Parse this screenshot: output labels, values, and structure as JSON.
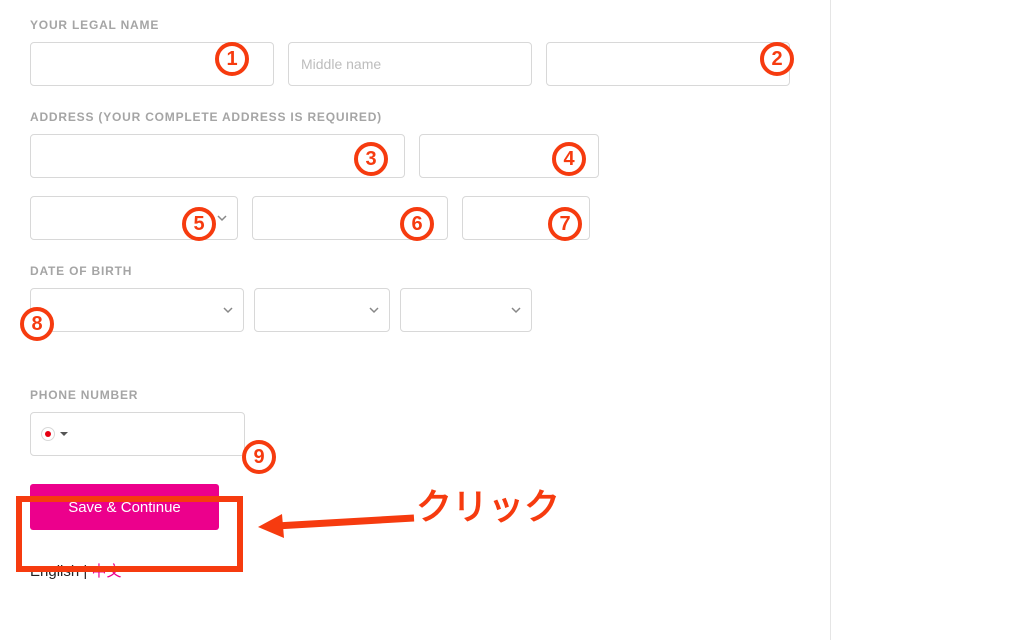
{
  "labels": {
    "legal_name": "YOUR LEGAL NAME",
    "address": "ADDRESS (YOUR COMPLETE ADDRESS IS REQUIRED)",
    "dob": "DATE OF BIRTH",
    "phone": "PHONE NUMBER"
  },
  "placeholders": {
    "middle_name": "Middle name"
  },
  "buttons": {
    "save": "Save & Continue"
  },
  "languages": {
    "en": "English",
    "sep": " | ",
    "zh": "中文"
  },
  "annotations": {
    "n1": "1",
    "n2": "2",
    "n3": "3",
    "n4": "4",
    "n5": "5",
    "n6": "6",
    "n7": "7",
    "n8": "8",
    "n9": "9",
    "click_text": "クリック"
  }
}
